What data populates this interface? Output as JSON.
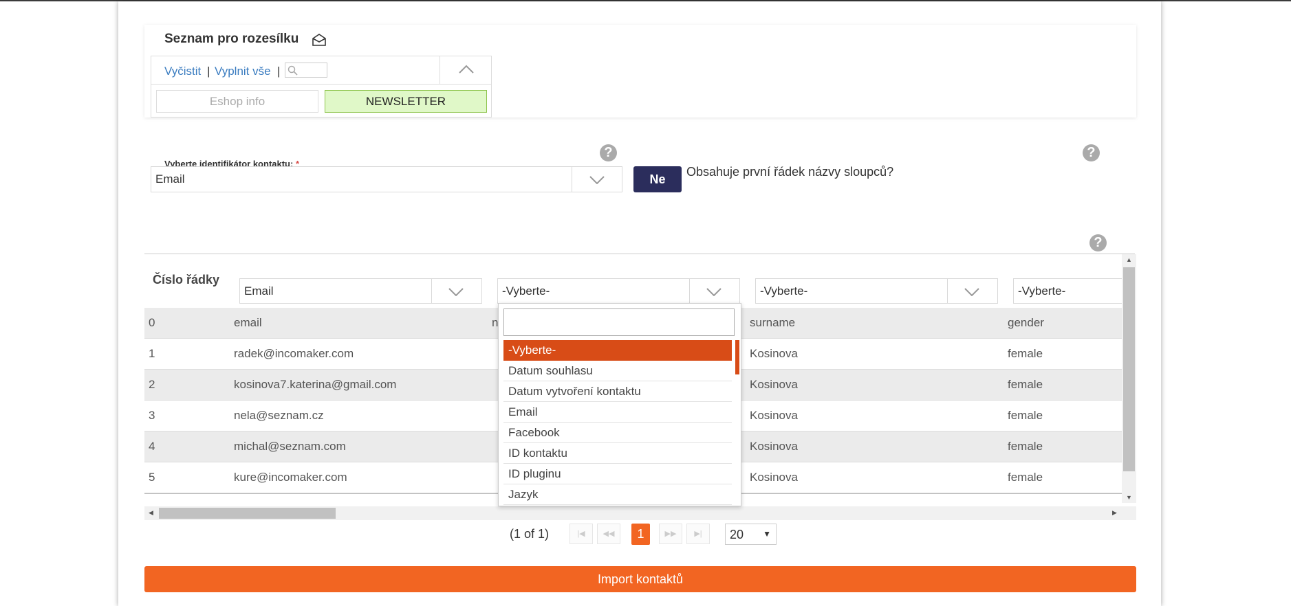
{
  "mailing_list": {
    "title": "Seznam pro rozesílku",
    "clear_label": "Vyčistit",
    "sep": "|",
    "fill_all_label": "Vyplnit vše",
    "options": [
      "Eshop info",
      "NEWSLETTER"
    ],
    "selected_option": "NEWSLETTER"
  },
  "identifier": {
    "label": "Vyberte identifikátor kontaktu:",
    "required_mark": "*",
    "value": "Email"
  },
  "header_row": {
    "button_label": "Ne",
    "question": "Obsahuje první řádek názvy sloupců?"
  },
  "help_mark": "?",
  "table": {
    "row_number_header": "Číslo řádky",
    "column_selects": [
      "Email",
      "-Vyberte-",
      "-Vyberte-",
      "-Vyberte-"
    ],
    "rows": [
      {
        "num": "0",
        "c1": "email",
        "c2": "n",
        "c3": "surname",
        "c4": "gender"
      },
      {
        "num": "1",
        "c1": "radek@incomaker.com",
        "c2": "",
        "c3": "Kosinova",
        "c4": "female"
      },
      {
        "num": "2",
        "c1": "kosinova7.katerina@gmail.com",
        "c2": "",
        "c3": "Kosinova",
        "c4": "female"
      },
      {
        "num": "3",
        "c1": "nela@seznam.cz",
        "c2": "",
        "c3": "Kosinova",
        "c4": "female"
      },
      {
        "num": "4",
        "c1": "michal@seznam.com",
        "c2": "",
        "c3": "Kosinova",
        "c4": "female"
      },
      {
        "num": "5",
        "c1": "kure@incomaker.com",
        "c2": "",
        "c3": "Kosinova",
        "c4": "female"
      }
    ]
  },
  "dropdown": {
    "search_value": "",
    "items": [
      "-Vyberte-",
      "Datum souhlasu",
      "Datum vytvoření kontaktu",
      "Email",
      "Facebook",
      "ID kontaktu",
      "ID pluginu",
      "Jazyk"
    ],
    "selected": "-Vyberte-"
  },
  "pagination": {
    "info": "(1 of 1)",
    "current_page": "1",
    "page_size": "20"
  },
  "import_button": "Import kontaktů",
  "colors": {
    "accent": "#f26522",
    "dropdown_selected": "#d84c17",
    "dark_button": "#2b2d5c",
    "link": "#3a7cc0",
    "newsletter_bg": "#e0f8c8"
  }
}
